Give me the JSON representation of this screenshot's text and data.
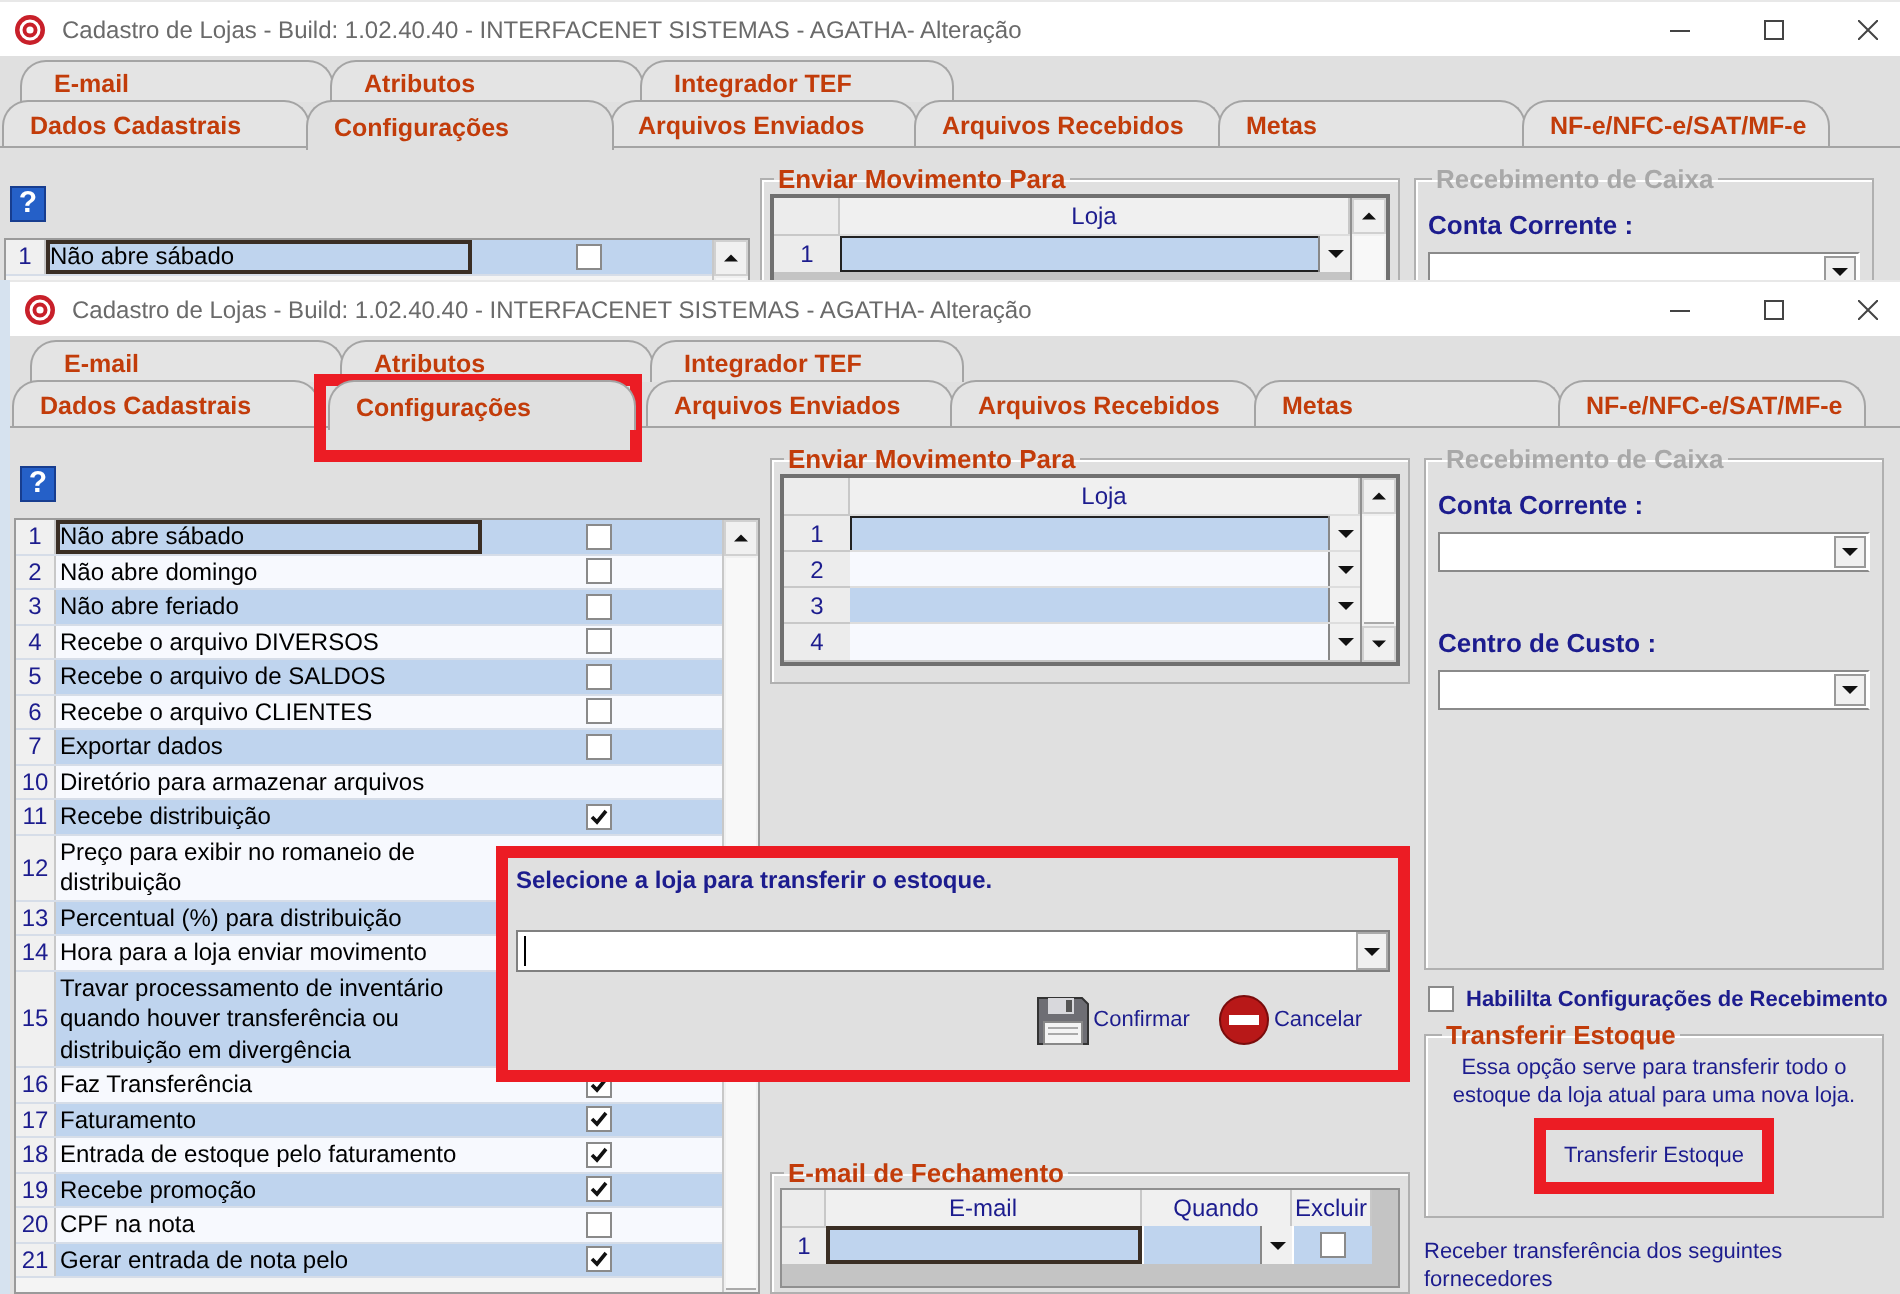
{
  "windows": [
    {
      "kind": "background",
      "title": "Cadastro de Lojas - Build: 1.02.40.40 - INTERFACENET SISTEMAS - AGATHA- Alteração",
      "tabs_back": [
        {
          "label": "E-mail",
          "selected": false,
          "highlighted": false
        },
        {
          "label": "Atributos",
          "selected": false,
          "highlighted": false
        },
        {
          "label": "Integrador TEF",
          "selected": false,
          "highlighted": false
        }
      ],
      "tabs_front": [
        {
          "label": "Dados Cadastrais",
          "selected": false,
          "highlighted": false
        },
        {
          "label": "Configurações",
          "selected": true,
          "highlighted": false
        },
        {
          "label": "Arquivos Enviados",
          "selected": false,
          "highlighted": false
        },
        {
          "label": "Arquivos Recebidos",
          "selected": false,
          "highlighted": false
        },
        {
          "label": "Metas",
          "selected": false,
          "highlighted": false
        },
        {
          "label": "NF-e/NFC-e/SAT/MF-e",
          "selected": false,
          "highlighted": false
        }
      ],
      "help_button": "?",
      "settings": [
        {
          "number": "1",
          "label": "Não abre sábado",
          "kind": "check",
          "checked": false,
          "selected": true
        }
      ],
      "send_to": {
        "title": "Enviar Movimento Para",
        "column": "Loja",
        "rows": [
          {
            "number": "1",
            "selected": true
          }
        ]
      },
      "cash_receipt": {
        "title": "Recebimento de Caixa",
        "disabled": true,
        "fields": [
          {
            "label": "Conta Corrente :"
          }
        ]
      }
    },
    {
      "kind": "foreground",
      "title": "Cadastro de Lojas - Build: 1.02.40.40 - INTERFACENET SISTEMAS - AGATHA- Alteração",
      "tabs_back": [
        {
          "label": "E-mail",
          "selected": false,
          "highlighted": false
        },
        {
          "label": "Atributos",
          "selected": false,
          "highlighted": false
        },
        {
          "label": "Integrador TEF",
          "selected": false,
          "highlighted": false
        }
      ],
      "tabs_front": [
        {
          "label": "Dados Cadastrais",
          "selected": false,
          "highlighted": false
        },
        {
          "label": "Configurações",
          "selected": true,
          "highlighted": true
        },
        {
          "label": "Arquivos Enviados",
          "selected": false,
          "highlighted": false
        },
        {
          "label": "Arquivos Recebidos",
          "selected": false,
          "highlighted": false
        },
        {
          "label": "Metas",
          "selected": false,
          "highlighted": false
        },
        {
          "label": "NF-e/NFC-e/SAT/MF-e",
          "selected": false,
          "highlighted": false
        }
      ],
      "help_button": "?",
      "settings": [
        {
          "number": "1",
          "label": "Não abre sábado",
          "kind": "check",
          "checked": false,
          "selected": true
        },
        {
          "number": "2",
          "label": "Não abre domingo",
          "kind": "check",
          "checked": false,
          "selected": false
        },
        {
          "number": "3",
          "label": "Não abre feriado",
          "kind": "check",
          "checked": false,
          "selected": false
        },
        {
          "number": "4",
          "label": "Recebe o arquivo DIVERSOS",
          "kind": "check",
          "checked": false,
          "selected": false
        },
        {
          "number": "5",
          "label": "Recebe o arquivo de SALDOS",
          "kind": "check",
          "checked": false,
          "selected": false
        },
        {
          "number": "6",
          "label": "Recebe o arquivo CLIENTES",
          "kind": "check",
          "checked": false,
          "selected": false
        },
        {
          "number": "7",
          "label": "Exportar dados",
          "kind": "check",
          "checked": false,
          "selected": false
        },
        {
          "number": "10",
          "label": "Diretório para armazenar arquivos",
          "kind": "text",
          "selected": false
        },
        {
          "number": "11",
          "label": "Recebe distribuição",
          "kind": "check",
          "checked": true,
          "selected": false
        },
        {
          "number": "12",
          "label": "Preço para exibir no romaneio de distribuição",
          "kind": "text",
          "selected": false
        },
        {
          "number": "13",
          "label": "Percentual (%) para distribuição",
          "kind": "text",
          "selected": false
        },
        {
          "number": "14",
          "label": "Hora para a loja enviar movimento",
          "kind": "text",
          "selected": false
        },
        {
          "number": "15",
          "label": "Travar processamento de inventário quando houver transferência ou distribuição em divergência",
          "kind": "text",
          "selected": false
        },
        {
          "number": "16",
          "label": "Faz Transferência",
          "kind": "check",
          "checked": true,
          "selected": false
        },
        {
          "number": "17",
          "label": "Faturamento",
          "kind": "check",
          "checked": true,
          "selected": false
        },
        {
          "number": "18",
          "label": "Entrada de estoque pelo faturamento",
          "kind": "check",
          "checked": true,
          "selected": false
        },
        {
          "number": "19",
          "label": "Recebe promoção",
          "kind": "check",
          "checked": true,
          "selected": false
        },
        {
          "number": "20",
          "label": "CPF na nota",
          "kind": "check",
          "checked": false,
          "selected": false
        },
        {
          "number": "21",
          "label": "Gerar entrada de nota pelo",
          "kind": "check",
          "checked": true,
          "selected": false
        }
      ],
      "send_to": {
        "title": "Enviar Movimento Para",
        "column": "Loja",
        "rows": [
          {
            "number": "1",
            "selected": true
          },
          {
            "number": "2",
            "selected": false
          },
          {
            "number": "3",
            "selected": false
          },
          {
            "number": "4",
            "selected": false
          }
        ]
      },
      "closing_email": {
        "title": "E-mail de Fechamento",
        "columns": [
          "E-mail",
          "Quando",
          "Excluir"
        ],
        "rows": [
          {
            "number": "1",
            "selected": true,
            "delete": false
          }
        ]
      },
      "cash_receipt": {
        "title": "Recebimento de Caixa",
        "disabled": true,
        "fields": [
          {
            "label": "Conta Corrente :"
          },
          {
            "label": "Centro de Custo :"
          }
        ]
      },
      "enable_receipt": {
        "label": "Habililta Configurações de Recebimento",
        "checked": false
      },
      "transfer": {
        "title": "Transferir Estoque",
        "description": "Essa opção serve para transferir todo o estoque da loja atual para uma nova loja.",
        "button": "Transferir Estoque",
        "highlighted": true
      },
      "suppliers_note": "Receber transferência dos seguintes fornecedores",
      "dialog": {
        "prompt": "Selecione a loja para transferir o estoque.",
        "highlighted": true,
        "buttons": [
          {
            "kind": "confirm",
            "label": "Confirmar"
          },
          {
            "kind": "cancel",
            "label": "Cancelar"
          }
        ]
      }
    }
  ]
}
